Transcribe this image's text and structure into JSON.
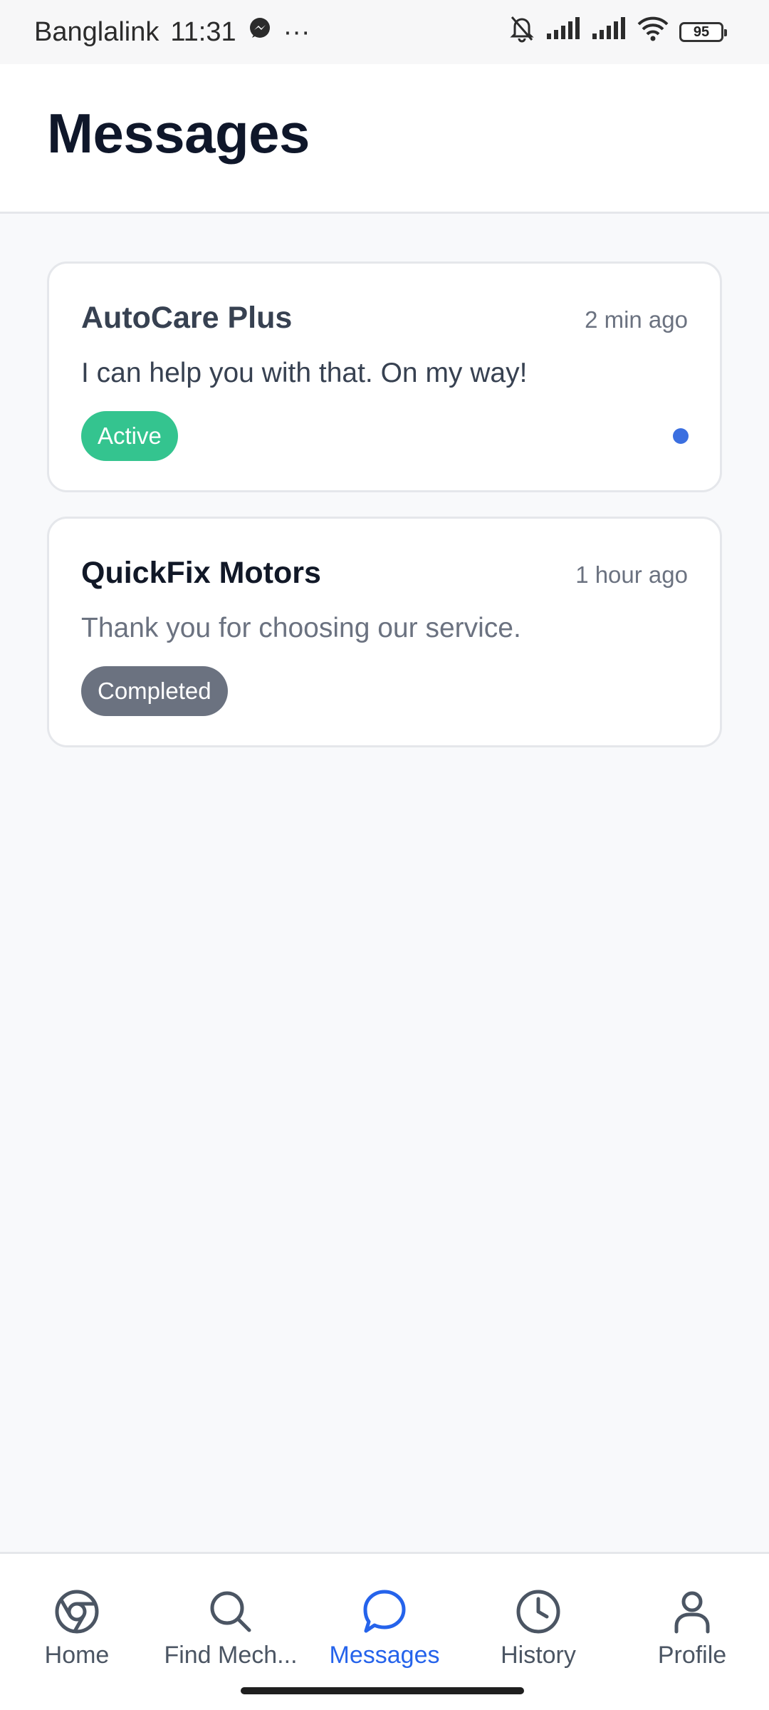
{
  "status_bar": {
    "carrier": "Banglalink",
    "time": "11:31",
    "more": "···",
    "battery": "95"
  },
  "header": {
    "title": "Messages"
  },
  "conversations": [
    {
      "name": "AutoCare Plus",
      "time": "2 min ago",
      "message": "I can help you with that. On my way!",
      "status": "Active",
      "status_color": "#34c48f",
      "unread": true,
      "name_color": "#374151",
      "message_color": "#374151"
    },
    {
      "name": "QuickFix Motors",
      "time": "1 hour ago",
      "message": "Thank you for choosing our service.",
      "status": "Completed",
      "status_color": "#6b7280",
      "unread": false,
      "name_color": "#111827",
      "message_color": "#6b7280"
    }
  ],
  "bottom_nav": {
    "active_color": "#2563eb",
    "inactive_color": "#4b5563",
    "items": [
      {
        "label": "Home",
        "icon": "chrome-icon"
      },
      {
        "label": "Find Mech...",
        "icon": "search-icon"
      },
      {
        "label": "Messages",
        "icon": "chat-bubble-icon",
        "active": true
      },
      {
        "label": "History",
        "icon": "clock-icon"
      },
      {
        "label": "Profile",
        "icon": "user-icon"
      }
    ]
  }
}
